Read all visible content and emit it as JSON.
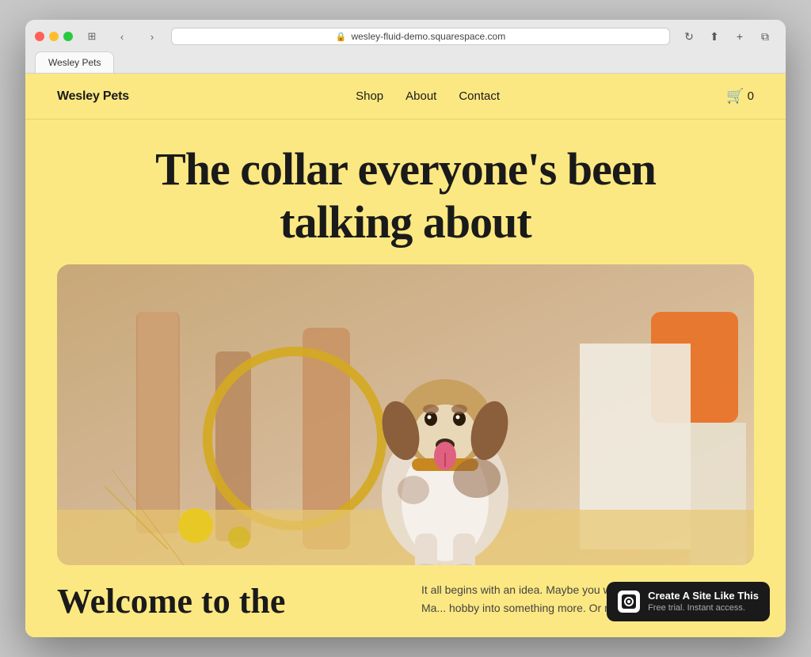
{
  "browser": {
    "url": "wesley-fluid-demo.squarespace.com",
    "tab_title": "Wesley Pets"
  },
  "nav": {
    "logo": "Wesley Pets",
    "links": [
      {
        "label": "Shop",
        "href": "#"
      },
      {
        "label": "About",
        "href": "#"
      },
      {
        "label": "Contact",
        "href": "#"
      }
    ],
    "cart_count": "0"
  },
  "hero": {
    "title_line1": "The collar everyone's been",
    "title_line2": "talking about"
  },
  "bottom": {
    "heading_line1": "Welcome to the",
    "body_text": "It all begins with an idea. Maybe you want to launch a business. Ma... hobby into something more. Or maybe you..."
  },
  "badge": {
    "main_text": "Create A Site Like This",
    "sub_text": "Free trial. Instant access."
  }
}
